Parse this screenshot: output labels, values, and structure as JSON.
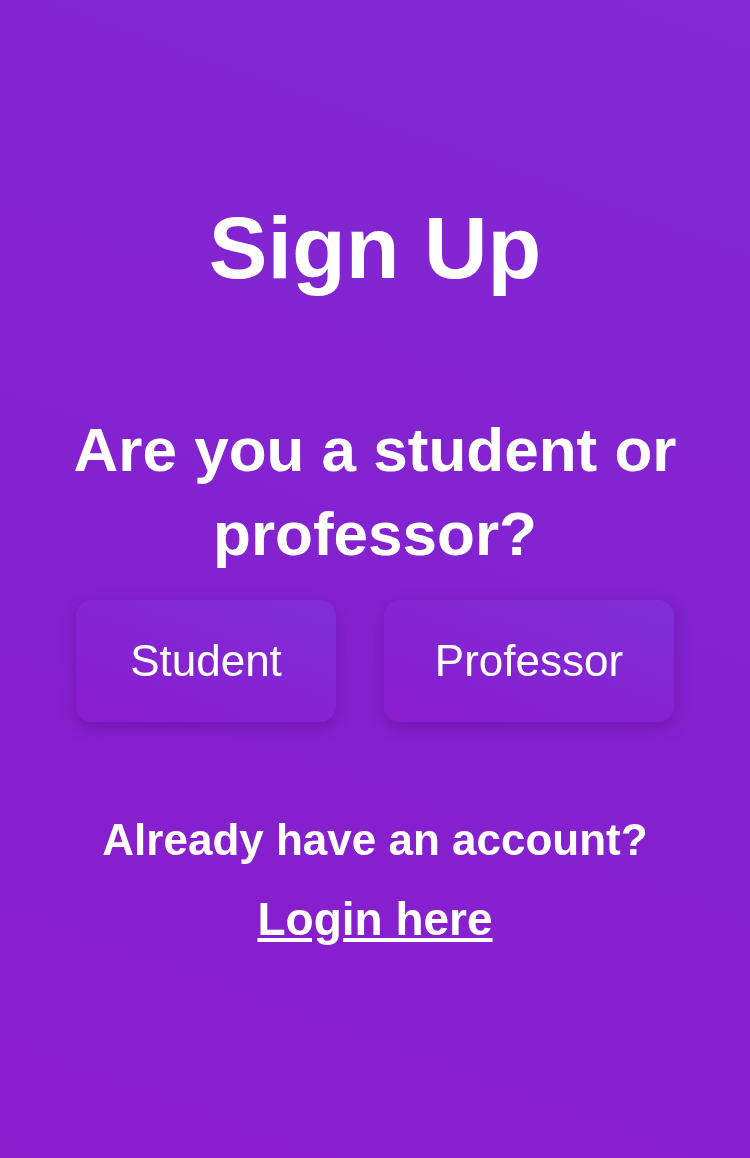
{
  "title": "Sign Up",
  "question": "Are you a student or professor?",
  "roles": [
    {
      "label": "Student"
    },
    {
      "label": "Professor"
    }
  ],
  "account_prompt": "Already have an account?",
  "login_link": "Login here"
}
